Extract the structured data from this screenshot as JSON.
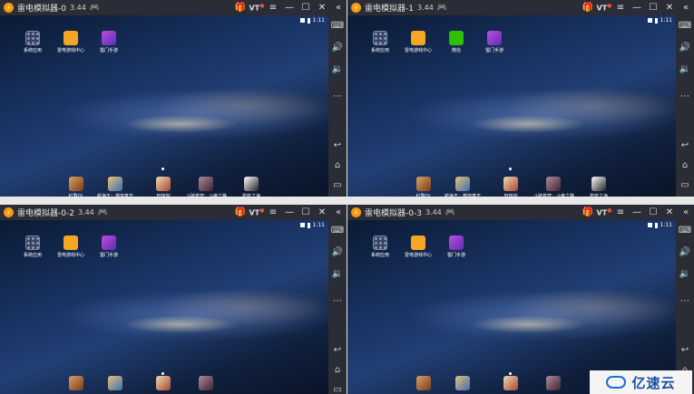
{
  "windows": [
    {
      "title": "雷电模拟器-0",
      "version": "3.44",
      "time": "1:11",
      "apps_top": [
        {
          "label": "系统应用",
          "icon": "system-apps-icon",
          "cls": "ic-sys"
        },
        {
          "label": "雷电游戏中心",
          "icon": "game-center-icon",
          "cls": "ic-center"
        },
        {
          "label": "蜀门手游",
          "icon": "game-app-icon",
          "cls": "ic-hand"
        }
      ],
      "apps_bottom": [
        {
          "label": "红警OL",
          "icon": "game-icon",
          "cls": "ic-g1"
        },
        {
          "label": "航海王：燃烧意志",
          "icon": "game-icon",
          "cls": "ic-g2"
        },
        {
          "label": "轩辕剑",
          "icon": "game-icon",
          "cls": "ic-g3"
        },
        {
          "label": "斗破苍穹：斗帝之路",
          "icon": "game-icon",
          "cls": "ic-g4"
        },
        {
          "label": "碧蓝之海",
          "icon": "game-icon",
          "cls": "ic-g5"
        }
      ]
    },
    {
      "title": "雷电模拟器-1",
      "version": "3.44",
      "time": "1:11",
      "apps_top": [
        {
          "label": "系统应用",
          "icon": "system-apps-icon",
          "cls": "ic-sys"
        },
        {
          "label": "雷电游戏中心",
          "icon": "game-center-icon",
          "cls": "ic-center"
        },
        {
          "label": "微信",
          "icon": "wechat-icon",
          "cls": "ic-wechat"
        },
        {
          "label": "蜀门手游",
          "icon": "game-app-icon",
          "cls": "ic-hand"
        }
      ],
      "apps_bottom": [
        {
          "label": "红警OL",
          "icon": "game-icon",
          "cls": "ic-g1"
        },
        {
          "label": "航海王：燃烧意志",
          "icon": "game-icon",
          "cls": "ic-g2"
        },
        {
          "label": "轩辕剑",
          "icon": "game-icon",
          "cls": "ic-g3"
        },
        {
          "label": "斗破苍穹：斗帝之路",
          "icon": "game-icon",
          "cls": "ic-g4"
        },
        {
          "label": "碧蓝之海",
          "icon": "game-icon",
          "cls": "ic-g5"
        }
      ]
    },
    {
      "title": "雷电模拟器-0-2",
      "version": "3.44",
      "time": "1:11",
      "apps_top": [
        {
          "label": "系统应用",
          "icon": "system-apps-icon",
          "cls": "ic-sys"
        },
        {
          "label": "雷电游戏中心",
          "icon": "game-center-icon",
          "cls": "ic-center"
        },
        {
          "label": "蜀门手游",
          "icon": "game-app-icon",
          "cls": "ic-hand"
        }
      ],
      "apps_bottom": [
        {
          "label": "",
          "icon": "game-icon",
          "cls": "ic-g1"
        },
        {
          "label": "",
          "icon": "game-icon",
          "cls": "ic-g2"
        },
        {
          "label": "",
          "icon": "game-icon",
          "cls": "ic-g3"
        },
        {
          "label": "",
          "icon": "game-icon",
          "cls": "ic-g4"
        }
      ]
    },
    {
      "title": "雷电模拟器-0-3",
      "version": "3.44",
      "time": "1:11",
      "apps_top": [
        {
          "label": "系统应用",
          "icon": "system-apps-icon",
          "cls": "ic-sys"
        },
        {
          "label": "雷电游戏中心",
          "icon": "game-center-icon",
          "cls": "ic-center"
        },
        {
          "label": "蜀门手游",
          "icon": "game-app-icon",
          "cls": "ic-hand"
        }
      ],
      "apps_bottom": [
        {
          "label": "",
          "icon": "game-icon",
          "cls": "ic-g1"
        },
        {
          "label": "",
          "icon": "game-icon",
          "cls": "ic-g2"
        },
        {
          "label": "",
          "icon": "game-icon",
          "cls": "ic-g3"
        },
        {
          "label": "",
          "icon": "game-icon",
          "cls": "ic-g4"
        }
      ]
    }
  ],
  "titlebar_buttons": {
    "vt": "VT",
    "menu": "≡",
    "minimize": "—",
    "maximize": "☐",
    "close": "✕",
    "collapse": "«"
  },
  "sidebar_buttons": [
    "keyboard",
    "volume-up",
    "volume-down",
    "more",
    "back",
    "home",
    "recent"
  ],
  "watermark": {
    "text": "亿速云"
  }
}
